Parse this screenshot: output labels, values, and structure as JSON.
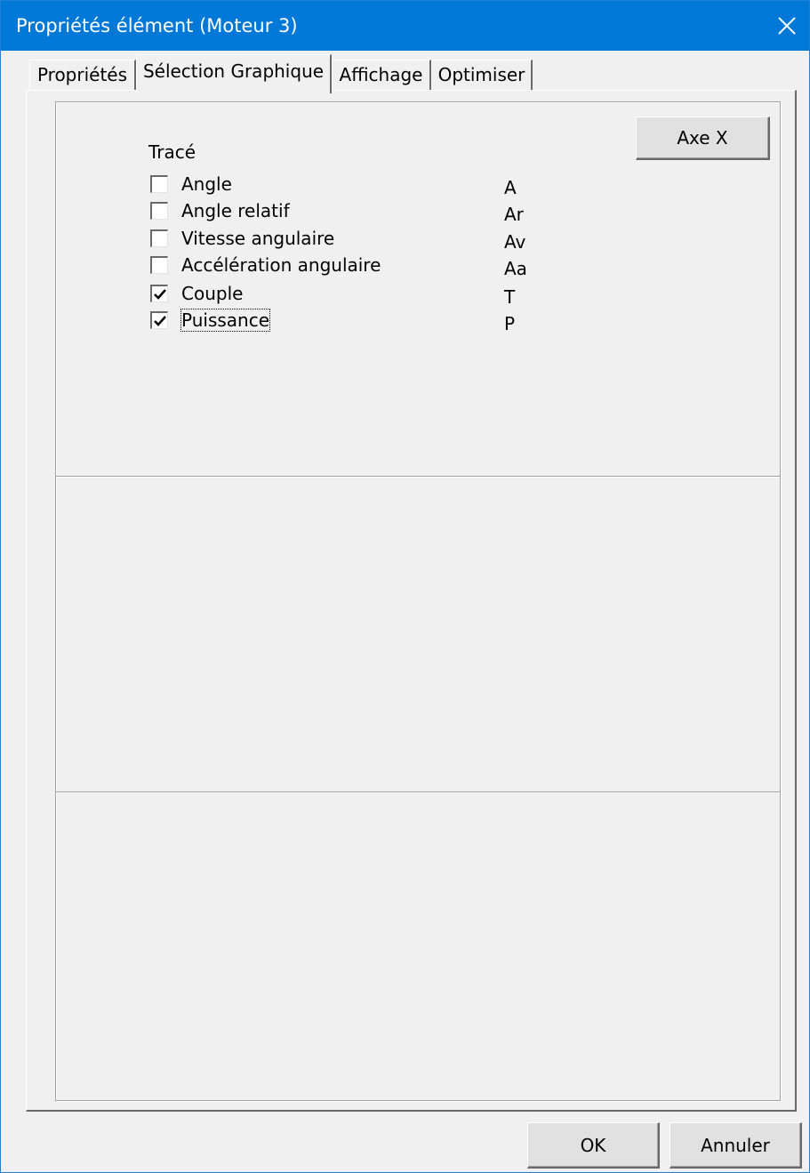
{
  "window": {
    "title": "Propriétés élément (Moteur 3)",
    "close_icon": "close-icon"
  },
  "tabs": [
    {
      "label": "Propriétés",
      "active": false
    },
    {
      "label": "Sélection Graphique",
      "active": true
    },
    {
      "label": "Affichage",
      "active": false
    },
    {
      "label": "Optimiser",
      "active": false
    }
  ],
  "selection": {
    "trace_label": "Tracé",
    "axe_button": "Axe X",
    "items": [
      {
        "label": "Angle",
        "abbr": "A",
        "checked": false,
        "focused": false
      },
      {
        "label": "Angle relatif",
        "abbr": "Ar",
        "checked": false,
        "focused": false
      },
      {
        "label": "Vitesse angulaire",
        "abbr": "Av",
        "checked": false,
        "focused": false
      },
      {
        "label": "Accélération angulaire",
        "abbr": "Aa",
        "checked": false,
        "focused": false
      },
      {
        "label": "Couple",
        "abbr": "T",
        "checked": true,
        "focused": false
      },
      {
        "label": "Puissance",
        "abbr": "P",
        "checked": true,
        "focused": true
      }
    ]
  },
  "footer": {
    "ok_label": "OK",
    "cancel_label": "Annuler"
  },
  "colors": {
    "titlebar": "#0078d7",
    "face": "#f0f0f0",
    "button": "#e1e1e1"
  }
}
